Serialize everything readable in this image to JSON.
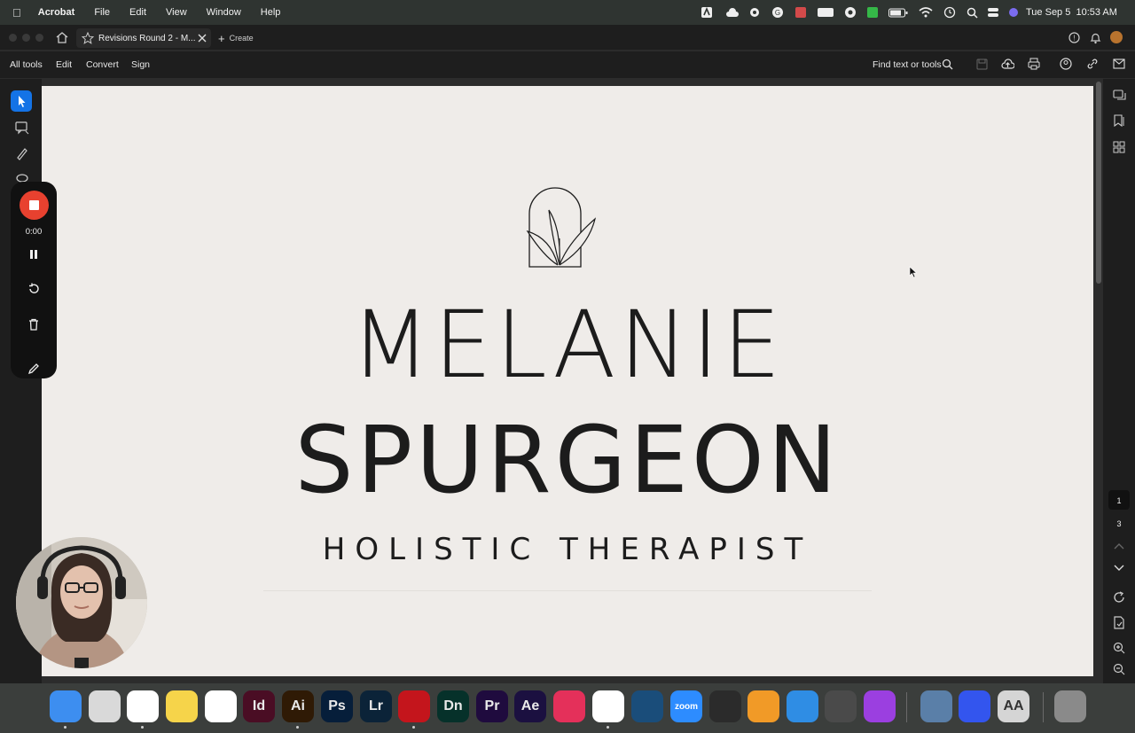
{
  "menubar": {
    "app": "Acrobat",
    "items": [
      "File",
      "Edit",
      "View",
      "Window",
      "Help"
    ],
    "clock": "Tue Sep 5  10:53 AM"
  },
  "tabbar": {
    "doc_tab": "Revisions Round 2 - M...",
    "create": "Create"
  },
  "toolbar": {
    "all_tools": "All tools",
    "edit": "Edit",
    "convert": "Convert",
    "sign": "Sign",
    "find": "Find text or tools"
  },
  "recorder": {
    "timer": "0:00"
  },
  "document": {
    "first_name": "MELANIE",
    "last_name": "SPURGEON",
    "tagline": "HOLISTIC THERAPIST"
  },
  "pages": {
    "current": "1",
    "total": "3"
  },
  "dock": {
    "apps": [
      {
        "name": "finder",
        "label": "",
        "color": "#3d8ef0"
      },
      {
        "name": "launchpad",
        "label": "",
        "color": "#d9d9d9"
      },
      {
        "name": "chrome",
        "label": "",
        "color": "#ffffff"
      },
      {
        "name": "notes",
        "label": "",
        "color": "#f6d44a"
      },
      {
        "name": "photos",
        "label": "",
        "color": "#ffffff"
      },
      {
        "name": "indesign",
        "label": "Id",
        "color": "#4a0d24"
      },
      {
        "name": "illustrator",
        "label": "Ai",
        "color": "#2f1a05"
      },
      {
        "name": "photoshop",
        "label": "Ps",
        "color": "#061e3a"
      },
      {
        "name": "lightroom",
        "label": "Lr",
        "color": "#0b2338"
      },
      {
        "name": "acrobat",
        "label": "",
        "color": "#c4151c"
      },
      {
        "name": "dimension",
        "label": "Dn",
        "color": "#06312a"
      },
      {
        "name": "premiere",
        "label": "Pr",
        "color": "#1f0b3e"
      },
      {
        "name": "after-effects",
        "label": "Ae",
        "color": "#1b1040"
      },
      {
        "name": "creative-cloud",
        "label": "",
        "color": "#e4305a"
      },
      {
        "name": "clickup",
        "label": "",
        "color": "#ffffff"
      },
      {
        "name": "quicktime",
        "label": "",
        "color": "#1a4d7a"
      },
      {
        "name": "zoom",
        "label": "zoom",
        "color": "#2d8cff"
      },
      {
        "name": "garageband",
        "label": "",
        "color": "#2b2b2b"
      },
      {
        "name": "pages",
        "label": "",
        "color": "#f19a27"
      },
      {
        "name": "keynote",
        "label": "",
        "color": "#2f8de4"
      },
      {
        "name": "calculator",
        "label": "",
        "color": "#4a4a4a"
      },
      {
        "name": "podcasts",
        "label": "",
        "color": "#9b3fe0"
      },
      {
        "name": "preview",
        "label": "",
        "color": "#5a7fa8"
      },
      {
        "name": "perplexity",
        "label": "",
        "color": "#3355ee"
      },
      {
        "name": "font-book",
        "label": "AA",
        "color": "#d5d5d5"
      },
      {
        "name": "trash",
        "label": "",
        "color": "#8a8a8a"
      }
    ]
  },
  "colors": {
    "menubar_bg": "#2f3431",
    "chrome_bg": "#1e1e1e",
    "page_bg": "#efece9",
    "record_red": "#e8412f",
    "select_blue": "#1473e6"
  }
}
